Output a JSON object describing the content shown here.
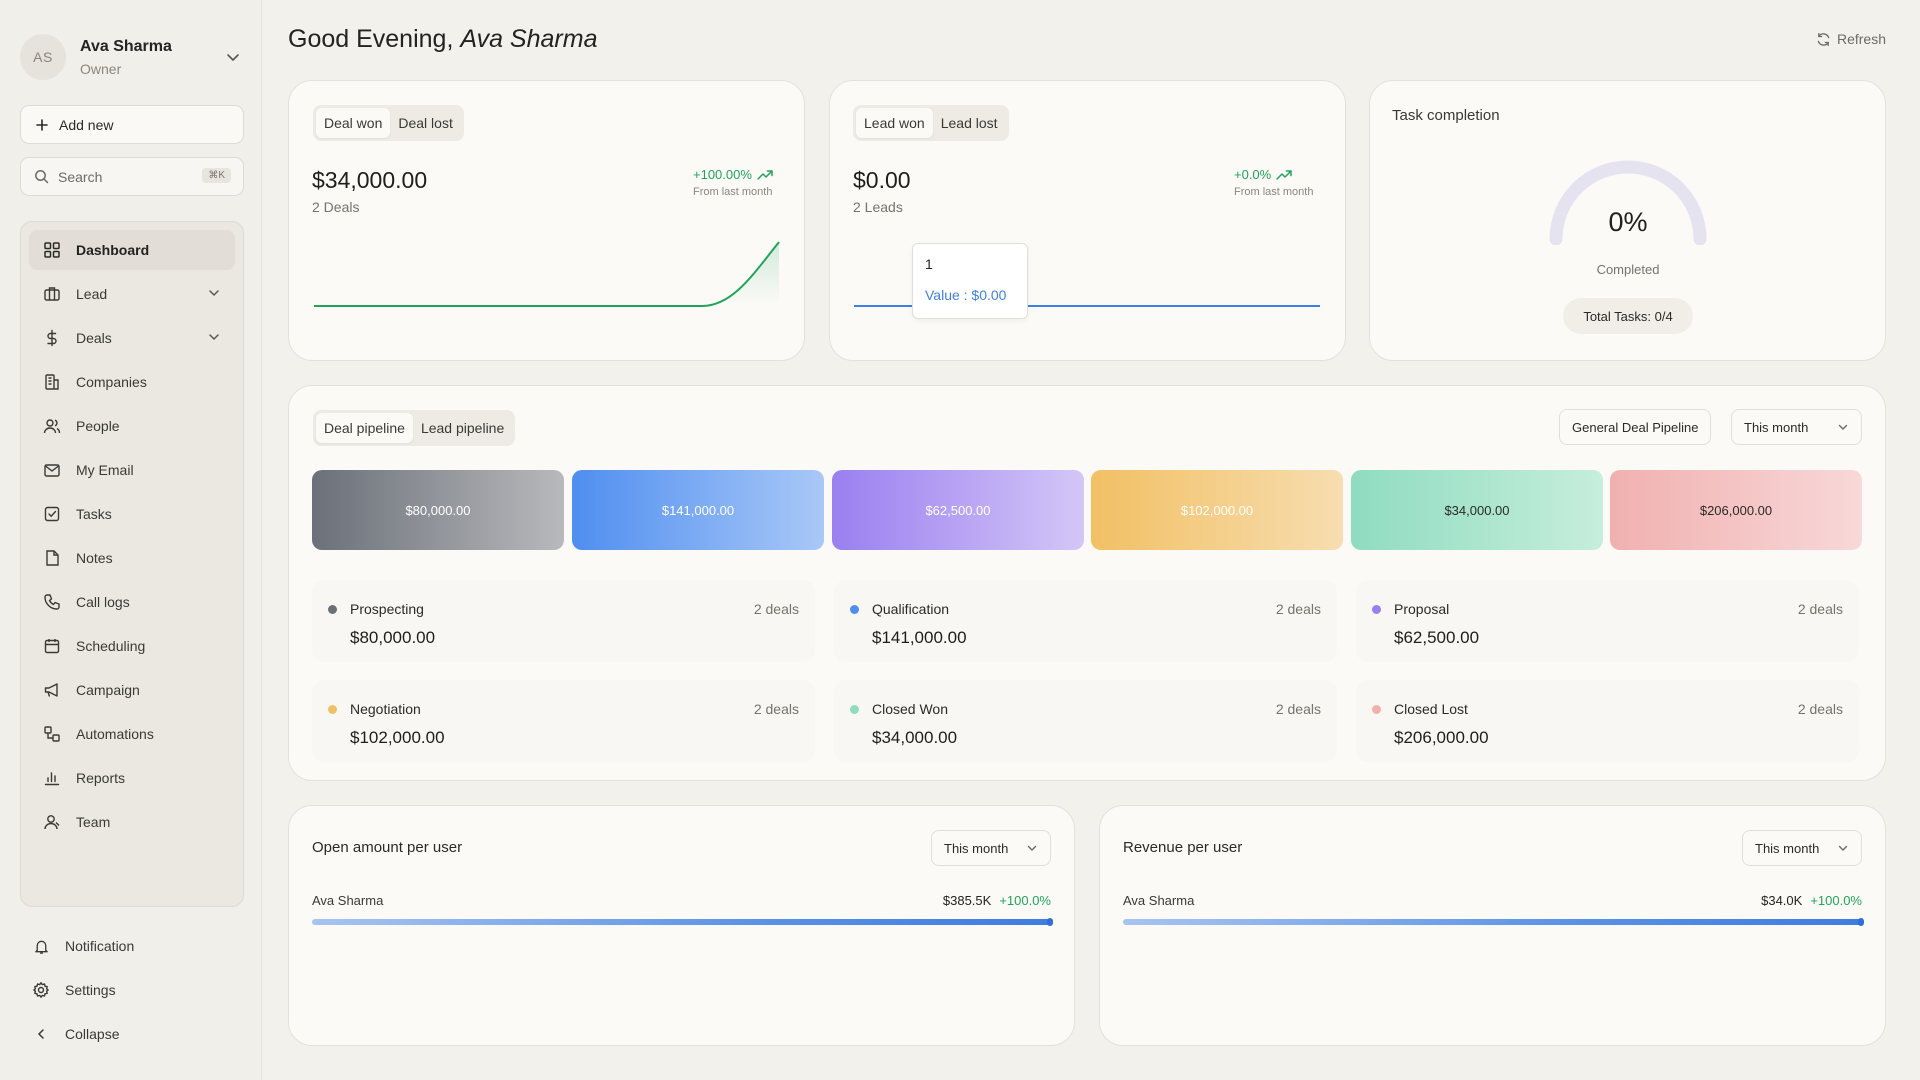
{
  "user": {
    "initials": "AS",
    "name": "Ava Sharma",
    "role": "Owner"
  },
  "sidebar": {
    "add_new": "Add new",
    "search_placeholder": "Search",
    "search_shortcut": "⌘K",
    "items": [
      {
        "label": "Dashboard",
        "icon": "grid-icon"
      },
      {
        "label": "Lead",
        "icon": "briefcase-icon"
      },
      {
        "label": "Deals",
        "icon": "dollar-icon"
      },
      {
        "label": "Companies",
        "icon": "building-icon"
      },
      {
        "label": "People",
        "icon": "people-icon"
      },
      {
        "label": "My Email",
        "icon": "mail-icon"
      },
      {
        "label": "Tasks",
        "icon": "checkbox-icon"
      },
      {
        "label": "Notes",
        "icon": "note-icon"
      },
      {
        "label": "Call logs",
        "icon": "phone-icon"
      },
      {
        "label": "Scheduling",
        "icon": "calendar-icon"
      },
      {
        "label": "Campaign",
        "icon": "megaphone-icon"
      },
      {
        "label": "Automations",
        "icon": "automation-icon"
      },
      {
        "label": "Reports",
        "icon": "bar-chart-icon"
      },
      {
        "label": "Team",
        "icon": "team-icon"
      }
    ],
    "bottom": [
      {
        "label": "Notification",
        "icon": "bell-icon"
      },
      {
        "label": "Settings",
        "icon": "gear-icon"
      },
      {
        "label": "Collapse",
        "icon": "chevron-left-icon"
      }
    ]
  },
  "header": {
    "greeting": "Good Evening,",
    "name": "Ava Sharma",
    "refresh": "Refresh"
  },
  "deals_card": {
    "tab_won": "Deal won",
    "tab_lost": "Deal lost",
    "amount": "$34,000.00",
    "count": "2 Deals",
    "delta": "+100.00%",
    "from_last": "From last month"
  },
  "leads_card": {
    "tab_won": "Lead won",
    "tab_lost": "Lead lost",
    "amount": "$0.00",
    "count": "2 Leads",
    "delta": "+0.0%",
    "from_last": "From last month",
    "tooltip_label": "1",
    "tooltip_value": "Value : $0.00"
  },
  "task_card": {
    "title": "Task completion",
    "percent": "0%",
    "completed": "Completed",
    "total": "Total Tasks: 0/4",
    "progress": 0
  },
  "pipeline": {
    "tab_deal": "Deal pipeline",
    "tab_lead": "Lead pipeline",
    "pipeline_select": "General Deal Pipeline",
    "period_select": "This month",
    "stages": [
      {
        "name": "Prospecting",
        "count": "2 deals",
        "amount": "$80,000.00",
        "bar_label": "$80,000.00",
        "color": "#6b7079"
      },
      {
        "name": "Qualification",
        "count": "2 deals",
        "amount": "$141,000.00",
        "bar_label": "$141,000.00",
        "color": "#4f8ef0"
      },
      {
        "name": "Proposal",
        "count": "2 deals",
        "amount": "$62,500.00",
        "bar_label": "$62,500.00",
        "color": "#9a7ff0"
      },
      {
        "name": "Negotiation",
        "count": "2 deals",
        "amount": "$102,000.00",
        "bar_label": "$102,000.00",
        "color": "#f2c064"
      },
      {
        "name": "Closed Won",
        "count": "2 deals",
        "amount": "$34,000.00",
        "bar_label": "$34,000.00",
        "color": "#8fdcc0"
      },
      {
        "name": "Closed Lost",
        "count": "2 deals",
        "amount": "$206,000.00",
        "bar_label": "$206,000.00",
        "color": "#f1b0b0"
      }
    ]
  },
  "open_amount": {
    "title": "Open amount per user",
    "period": "This month",
    "user": "Ava Sharma",
    "amount": "$385.5K",
    "delta": "+100.0%",
    "progress": 1.0
  },
  "revenue": {
    "title": "Revenue per user",
    "period": "This month",
    "user": "Ava Sharma",
    "amount": "$34.0K",
    "delta": "+100.0%",
    "progress": 1.0
  },
  "colors": {
    "accent_green": "#22a35a",
    "accent_blue": "#3f7fe4"
  }
}
